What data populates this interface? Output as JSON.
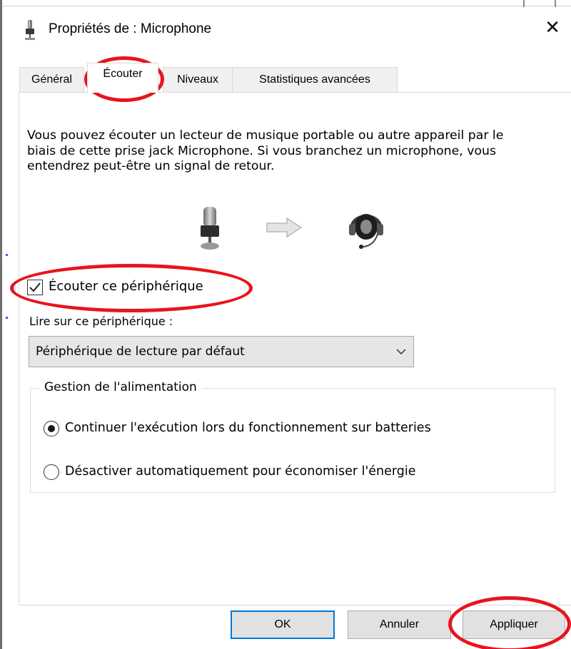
{
  "window": {
    "title": "Propriétés de : Microphone",
    "close_glyph": "✕",
    "title_icon": "microphone-icon"
  },
  "tabs": [
    {
      "label": "Général",
      "active": false
    },
    {
      "label": "Écouter",
      "active": true
    },
    {
      "label": "Niveaux",
      "active": false
    },
    {
      "label": "Statistiques avancées",
      "active": false
    }
  ],
  "listen": {
    "description": "Vous pouvez écouter un lecteur de musique portable ou autre appareil par le biais de cette prise jack Microphone. Si vous branchez un microphone, vous entendrez peut-être un signal de retour.",
    "flow_icons": [
      "microphone-icon",
      "arrow-right-icon",
      "headset-icon"
    ],
    "listen_checkbox": {
      "label": "Écouter ce périphérique",
      "checked": true
    },
    "playback_label": "Lire sur ce périphérique :",
    "playback_device": "Périphérique de lecture par défaut"
  },
  "power": {
    "group_title": "Gestion de l'alimentation",
    "options": [
      {
        "label": "Continuer l'exécution lors du fonctionnement sur batteries",
        "selected": true
      },
      {
        "label": "Désactiver automatiquement pour économiser l'énergie",
        "selected": false
      }
    ]
  },
  "buttons": {
    "ok": "OK",
    "cancel": "Annuler",
    "apply": "Appliquer"
  },
  "colors": {
    "annotation": "#e8141b",
    "default_button_border": "#0078d7"
  }
}
